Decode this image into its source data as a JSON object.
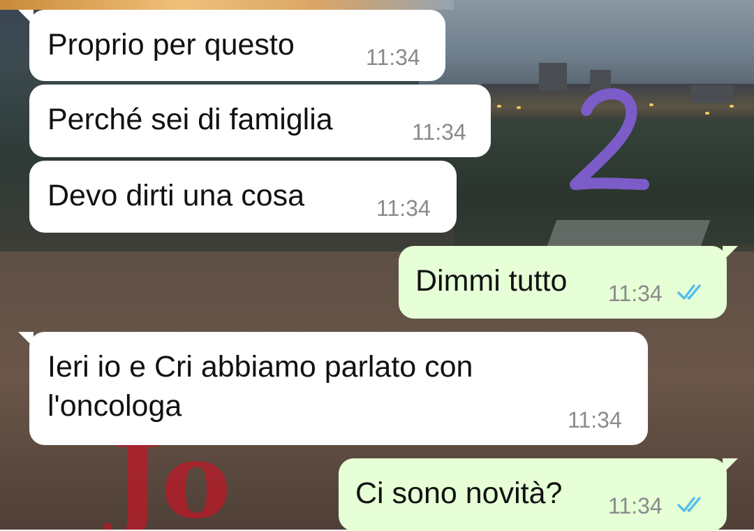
{
  "chat": {
    "messages": [
      {
        "direction": "incoming",
        "text": "Proprio per questo",
        "time": "11:34"
      },
      {
        "direction": "incoming",
        "text": "Perché sei di famiglia",
        "time": "11:34"
      },
      {
        "direction": "incoming",
        "text": "Devo dirti una cosa",
        "time": "11:34"
      },
      {
        "direction": "outgoing",
        "text": "Dimmi tutto",
        "time": "11:34",
        "status": "read"
      },
      {
        "direction": "incoming",
        "text": "Ieri io e Cri abbiamo parlato con l'oncologa",
        "time": "11:34"
      },
      {
        "direction": "outgoing",
        "text": "Ci sono novità?",
        "time": "11:34",
        "status": "read"
      }
    ]
  },
  "annotation": {
    "label": "2",
    "color": "#7b5cc8"
  },
  "colors": {
    "incoming_bubble": "#ffffff",
    "outgoing_bubble": "#e6ffd6",
    "read_ticks": "#53bdeb",
    "timestamp": "#8a8a8a"
  },
  "icons": {
    "read_receipt": "double-check-icon"
  }
}
